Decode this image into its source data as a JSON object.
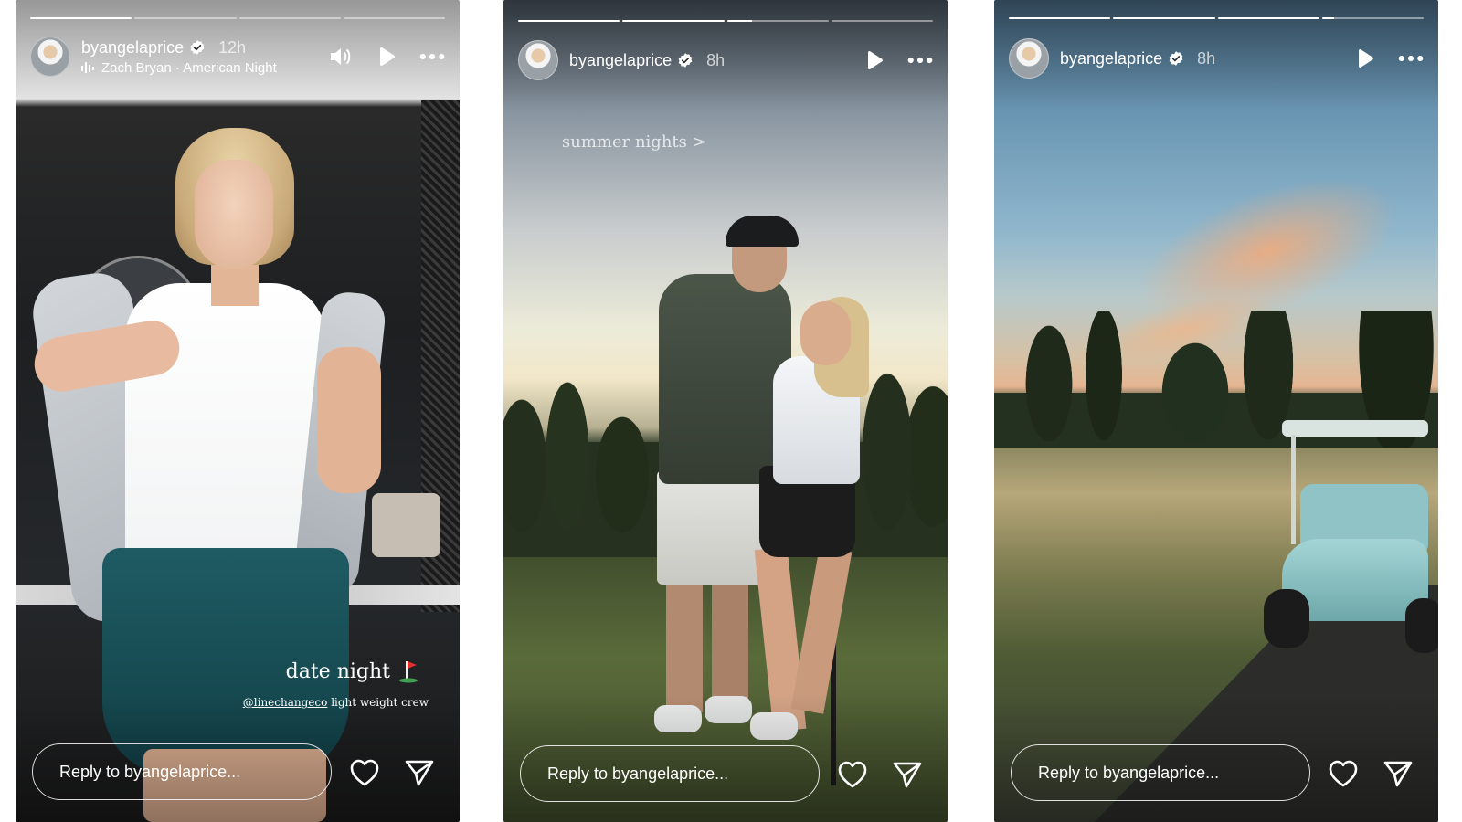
{
  "stories": [
    {
      "username": "byangelaprice",
      "time": "12h",
      "music": "Zach Bryan · American Night",
      "progress": [
        1.0,
        0.0,
        0.0,
        0.0
      ],
      "captions": {
        "date_night": "date night",
        "mention": "@linechangeco",
        "product": "light weight crew"
      },
      "reply_placeholder": "Reply to byangelaprice..."
    },
    {
      "username": "byangelaprice",
      "time": "8h",
      "progress": [
        1.0,
        1.0,
        0.25,
        0.0
      ],
      "captions": {
        "summer": "summer nights >"
      },
      "reply_placeholder": "Reply to byangelaprice..."
    },
    {
      "username": "byangelaprice",
      "time": "8h",
      "progress": [
        1.0,
        1.0,
        1.0,
        0.12
      ],
      "reply_placeholder": "Reply to byangelaprice..."
    }
  ],
  "icons": {
    "verified": "verified-badge-icon",
    "sound": "speaker-icon",
    "play": "play-icon",
    "more": "more-dots-icon",
    "audio": "audio-bars-icon",
    "like": "heart-icon",
    "share": "send-icon",
    "flag": "golf-flag-icon"
  },
  "colors": {
    "verified_badge": "#ffffff",
    "flag": "#e0312f",
    "ui_text": "#ffffff"
  }
}
